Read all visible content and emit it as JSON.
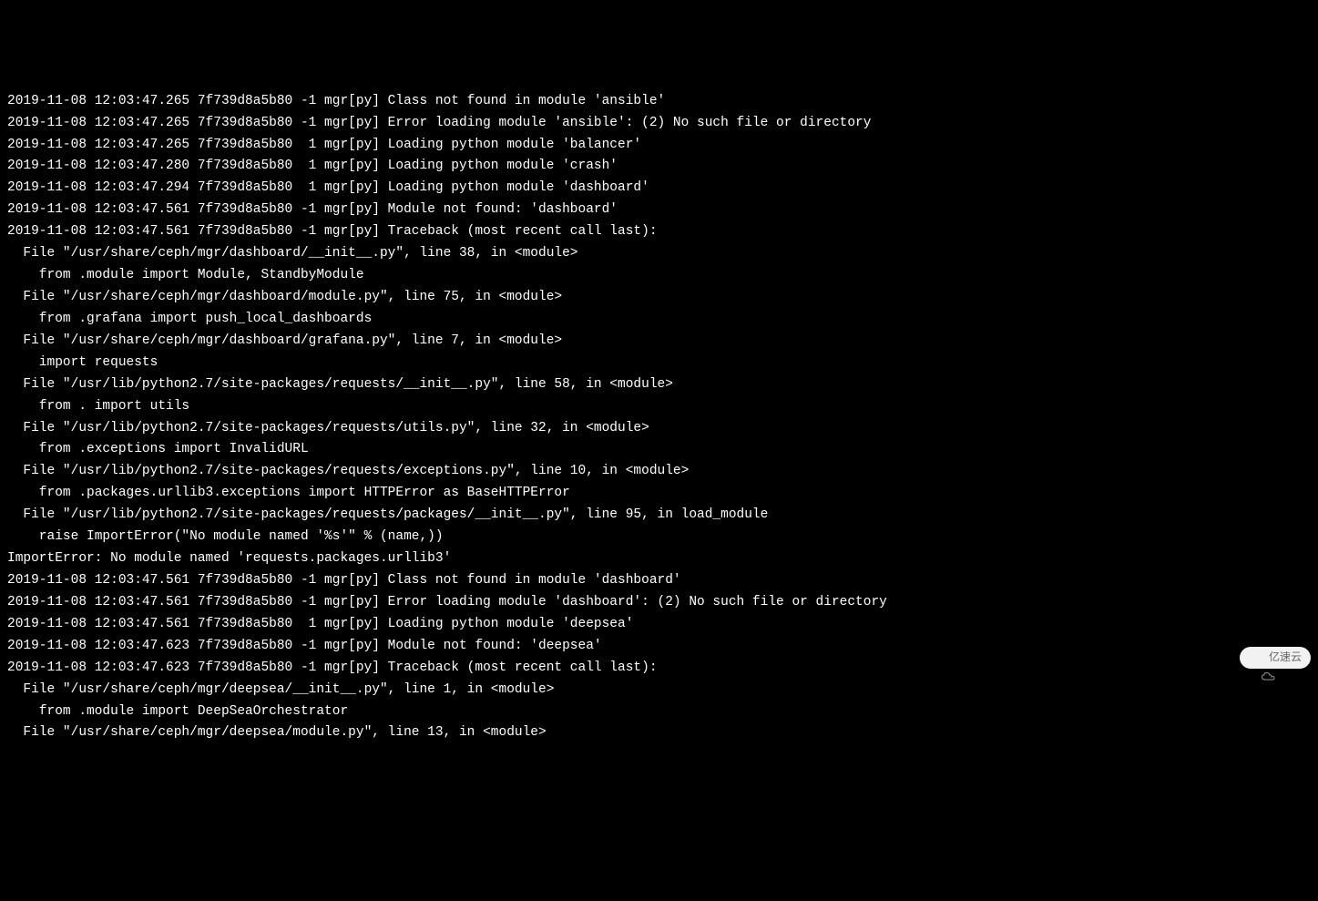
{
  "log_lines": [
    "2019-11-08 12:03:47.265 7f739d8a5b80 -1 mgr[py] Class not found in module 'ansible'",
    "2019-11-08 12:03:47.265 7f739d8a5b80 -1 mgr[py] Error loading module 'ansible': (2) No such file or directory",
    "2019-11-08 12:03:47.265 7f739d8a5b80  1 mgr[py] Loading python module 'balancer'",
    "2019-11-08 12:03:47.280 7f739d8a5b80  1 mgr[py] Loading python module 'crash'",
    "2019-11-08 12:03:47.294 7f739d8a5b80  1 mgr[py] Loading python module 'dashboard'",
    "2019-11-08 12:03:47.561 7f739d8a5b80 -1 mgr[py] Module not found: 'dashboard'",
    "2019-11-08 12:03:47.561 7f739d8a5b80 -1 mgr[py] Traceback (most recent call last):",
    "  File \"/usr/share/ceph/mgr/dashboard/__init__.py\", line 38, in <module>",
    "    from .module import Module, StandbyModule",
    "  File \"/usr/share/ceph/mgr/dashboard/module.py\", line 75, in <module>",
    "    from .grafana import push_local_dashboards",
    "  File \"/usr/share/ceph/mgr/dashboard/grafana.py\", line 7, in <module>",
    "    import requests",
    "  File \"/usr/lib/python2.7/site-packages/requests/__init__.py\", line 58, in <module>",
    "    from . import utils",
    "  File \"/usr/lib/python2.7/site-packages/requests/utils.py\", line 32, in <module>",
    "    from .exceptions import InvalidURL",
    "  File \"/usr/lib/python2.7/site-packages/requests/exceptions.py\", line 10, in <module>",
    "    from .packages.urllib3.exceptions import HTTPError as BaseHTTPError",
    "  File \"/usr/lib/python2.7/site-packages/requests/packages/__init__.py\", line 95, in load_module",
    "    raise ImportError(\"No module named '%s'\" % (name,))",
    "ImportError: No module named 'requests.packages.urllib3'",
    "",
    "2019-11-08 12:03:47.561 7f739d8a5b80 -1 mgr[py] Class not found in module 'dashboard'",
    "2019-11-08 12:03:47.561 7f739d8a5b80 -1 mgr[py] Error loading module 'dashboard': (2) No such file or directory",
    "2019-11-08 12:03:47.561 7f739d8a5b80  1 mgr[py] Loading python module 'deepsea'",
    "2019-11-08 12:03:47.623 7f739d8a5b80 -1 mgr[py] Module not found: 'deepsea'",
    "2019-11-08 12:03:47.623 7f739d8a5b80 -1 mgr[py] Traceback (most recent call last):",
    "  File \"/usr/share/ceph/mgr/deepsea/__init__.py\", line 1, in <module>",
    "    from .module import DeepSeaOrchestrator",
    "  File \"/usr/share/ceph/mgr/deepsea/module.py\", line 13, in <module>"
  ],
  "watermark": {
    "text": "亿速云"
  }
}
